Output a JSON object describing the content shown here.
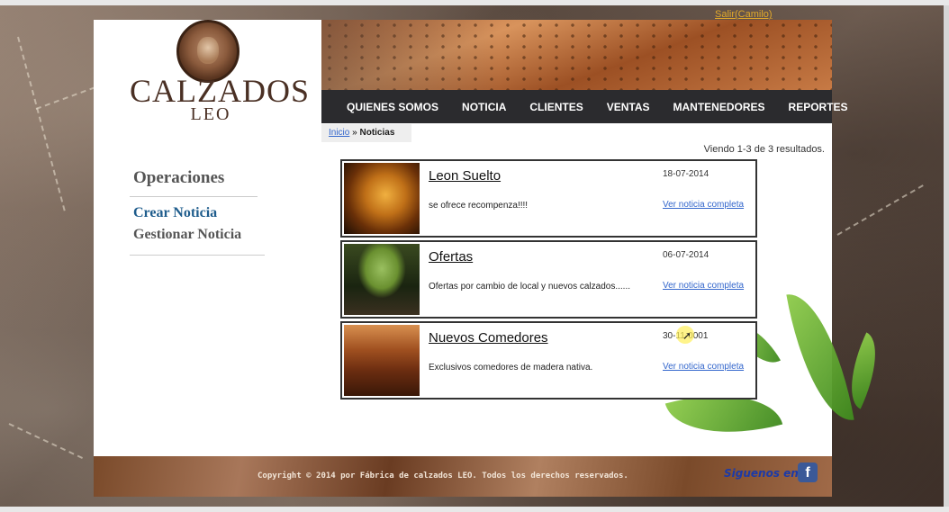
{
  "header": {
    "logo_main": "CALZADOS",
    "logo_sub": "LEO",
    "logout_link": "Salir(Camilo)"
  },
  "nav": {
    "items": [
      {
        "label": "QUIENES SOMOS"
      },
      {
        "label": "NOTICIA"
      },
      {
        "label": "CLIENTES"
      },
      {
        "label": "VENTAS"
      },
      {
        "label": "MANTENEDORES"
      },
      {
        "label": "REPORTES"
      }
    ]
  },
  "breadcrumb": {
    "home": "Inicio",
    "separator": " » ",
    "current": "Noticias"
  },
  "results": "Viendo 1-3 de 3 resultados.",
  "sidebar": {
    "title": "Operaciones",
    "links": [
      {
        "label": "Crear Noticia",
        "color": "#1e5c8c"
      },
      {
        "label": "Gestionar Noticia",
        "color": "#555555"
      }
    ]
  },
  "news": [
    {
      "title": "Leon Suelto",
      "date": "18-07-2014",
      "summary": "se ofrece recompenza!!!!",
      "more": "Ver noticia completa",
      "image": "lion-image"
    },
    {
      "title": "Ofertas",
      "date": "06-07-2014",
      "summary": "Ofertas por cambio de local y nuevos calzados......",
      "more": "Ver noticia completa",
      "image": "bonsai-image"
    },
    {
      "title": "Nuevos Comedores",
      "date": "30-11-0001",
      "summary": "Exclusivos comedores de madera nativa.",
      "more": "Ver noticia completa",
      "image": "dining-room-image"
    }
  ],
  "footer": {
    "copyright": "Copyright © 2014 por Fábrica de calzados LEO. Todos los derechos reservados.",
    "follow": "Siguenos en:",
    "facebook_icon": "f"
  },
  "colors": {
    "nav_bg": "#2b2b2e",
    "link": "#3366cc",
    "logout": "#e2a92a",
    "brand": "#4a3024"
  }
}
